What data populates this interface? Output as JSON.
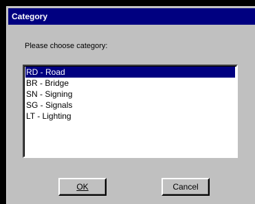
{
  "window": {
    "title": "Category"
  },
  "prompt": "Please choose category:",
  "list": {
    "selected_index": 0,
    "items": [
      {
        "label": "RD - Road"
      },
      {
        "label": "BR - Bridge"
      },
      {
        "label": "SN - Signing"
      },
      {
        "label": "SG - Signals"
      },
      {
        "label": "LT - Lighting"
      }
    ]
  },
  "buttons": {
    "ok_label": "OK",
    "cancel_label": "Cancel"
  },
  "colors": {
    "title_bar": "#000080",
    "selection": "#000080",
    "face": "#c0c0c0"
  }
}
